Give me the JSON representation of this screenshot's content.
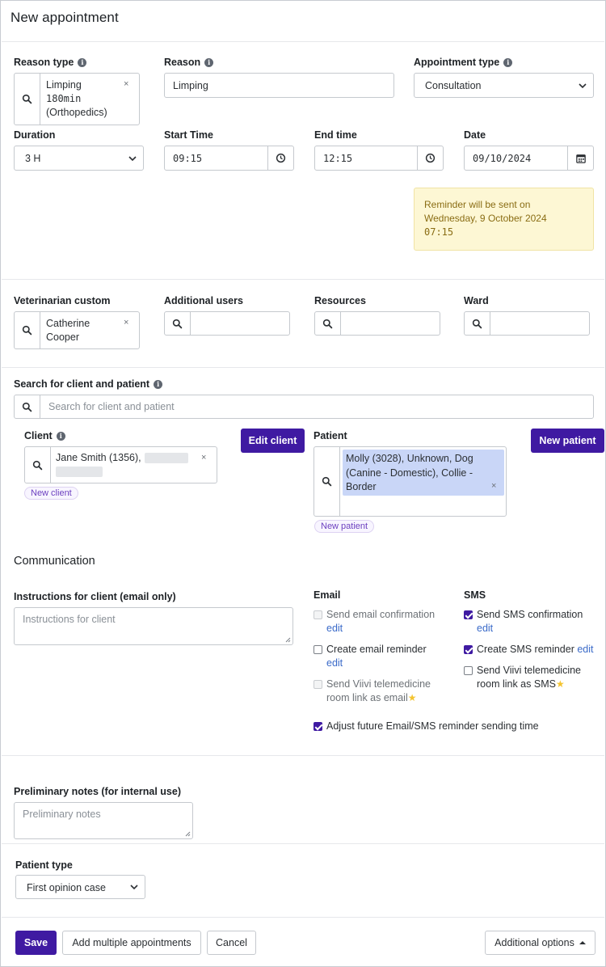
{
  "title": "New appointment",
  "reason_type": {
    "label": "Reason type",
    "value_line1": "Limping",
    "value_line2": "180min",
    "value_line3": "(Orthopedics)",
    "clear": "×"
  },
  "reason": {
    "label": "Reason",
    "value": "Limping"
  },
  "appointment_type": {
    "label": "Appointment type",
    "value": "Consultation"
  },
  "duration": {
    "label": "Duration",
    "value": "3 H"
  },
  "start_time": {
    "label": "Start Time",
    "value": "09:15"
  },
  "end_time": {
    "label": "End time",
    "value": "12:15"
  },
  "date": {
    "label": "Date",
    "value": "09/10/2024"
  },
  "reminder": {
    "line1": "Reminder will be sent on",
    "line2": "Wednesday, 9 October 2024",
    "line3": "07:15"
  },
  "veterinarian": {
    "label": "Veterinarian custom",
    "value_line1": "Catherine",
    "value_line2": "Cooper",
    "clear": "×"
  },
  "additional_users": {
    "label": "Additional users"
  },
  "resources": {
    "label": "Resources"
  },
  "ward": {
    "label": "Ward"
  },
  "search_client_patient": {
    "label": "Search for client and patient",
    "placeholder": "Search for client and patient"
  },
  "client": {
    "label": "Client",
    "value": "Jane Smith (1356),",
    "clear": "×",
    "new_pill": "New client"
  },
  "edit_client_button": "Edit client",
  "patient": {
    "label": "Patient",
    "value_line1": "Molly (3028), Unknown, Dog",
    "value_line2": "(Canine - Domestic), Collie -",
    "value_line3": "Border",
    "clear": "×",
    "new_pill": "New patient"
  },
  "new_patient_button": "New patient",
  "communication": {
    "heading": "Communication",
    "instructions_label": "Instructions for client (email only)",
    "instructions_placeholder": "Instructions for client",
    "email": {
      "heading": "Email",
      "send_confirmation": "Send email confirmation",
      "send_confirmation_edit": "edit",
      "create_reminder": "Create email reminder",
      "create_reminder_edit": "edit",
      "telemedicine_line1": "Send Viivi telemedicine",
      "telemedicine_line2": "room link as email"
    },
    "sms": {
      "heading": "SMS",
      "send_confirmation": "Send SMS confirmation",
      "send_confirmation_edit": "edit",
      "create_reminder": "Create SMS reminder",
      "create_reminder_edit": "edit",
      "telemedicine_line1": "Send Viivi telemedicine",
      "telemedicine_line2": "room link as SMS"
    },
    "adjust_future": "Adjust future Email/SMS reminder sending time"
  },
  "preliminary_notes": {
    "label": "Preliminary notes (for internal use)",
    "placeholder": "Preliminary notes"
  },
  "patient_type": {
    "label": "Patient type",
    "value": "First opinion case"
  },
  "footer": {
    "save": "Save",
    "add_multiple": "Add multiple appointments",
    "cancel": "Cancel",
    "additional_options": "Additional options"
  },
  "colors": {
    "primary": "#3f1aa2",
    "link": "#3b6bc9",
    "reminder_bg": "#fdf7d4",
    "selection_bg": "#c9d6f7"
  }
}
